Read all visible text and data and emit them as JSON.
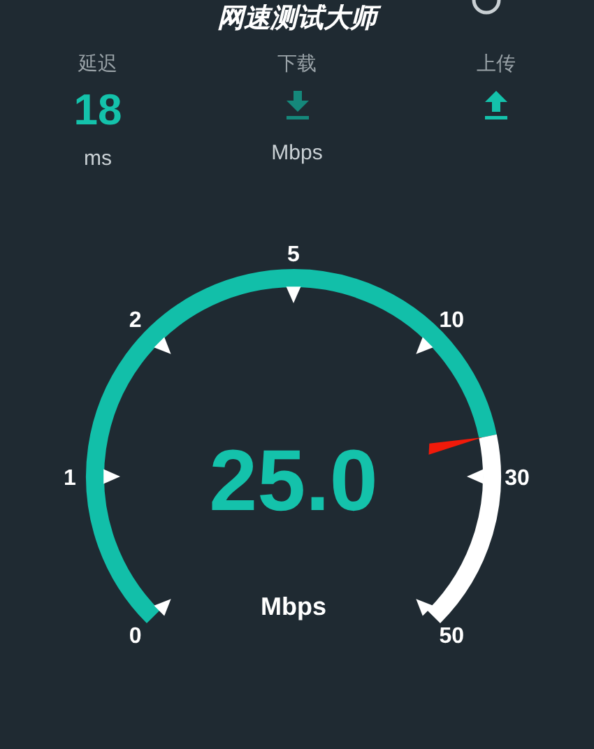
{
  "title": "网速测试大师",
  "stats": [
    {
      "kind": "value",
      "label": "延迟",
      "value": "18",
      "unit": "ms"
    },
    {
      "kind": "download",
      "label": "下载",
      "unit": "Mbps"
    },
    {
      "kind": "upload",
      "label": "上传"
    }
  ],
  "gauge": {
    "reading": "25.0",
    "unit": "Mbps",
    "scale_labels": [
      "0",
      "1",
      "2",
      "5",
      "10",
      "30",
      "50"
    ]
  }
}
